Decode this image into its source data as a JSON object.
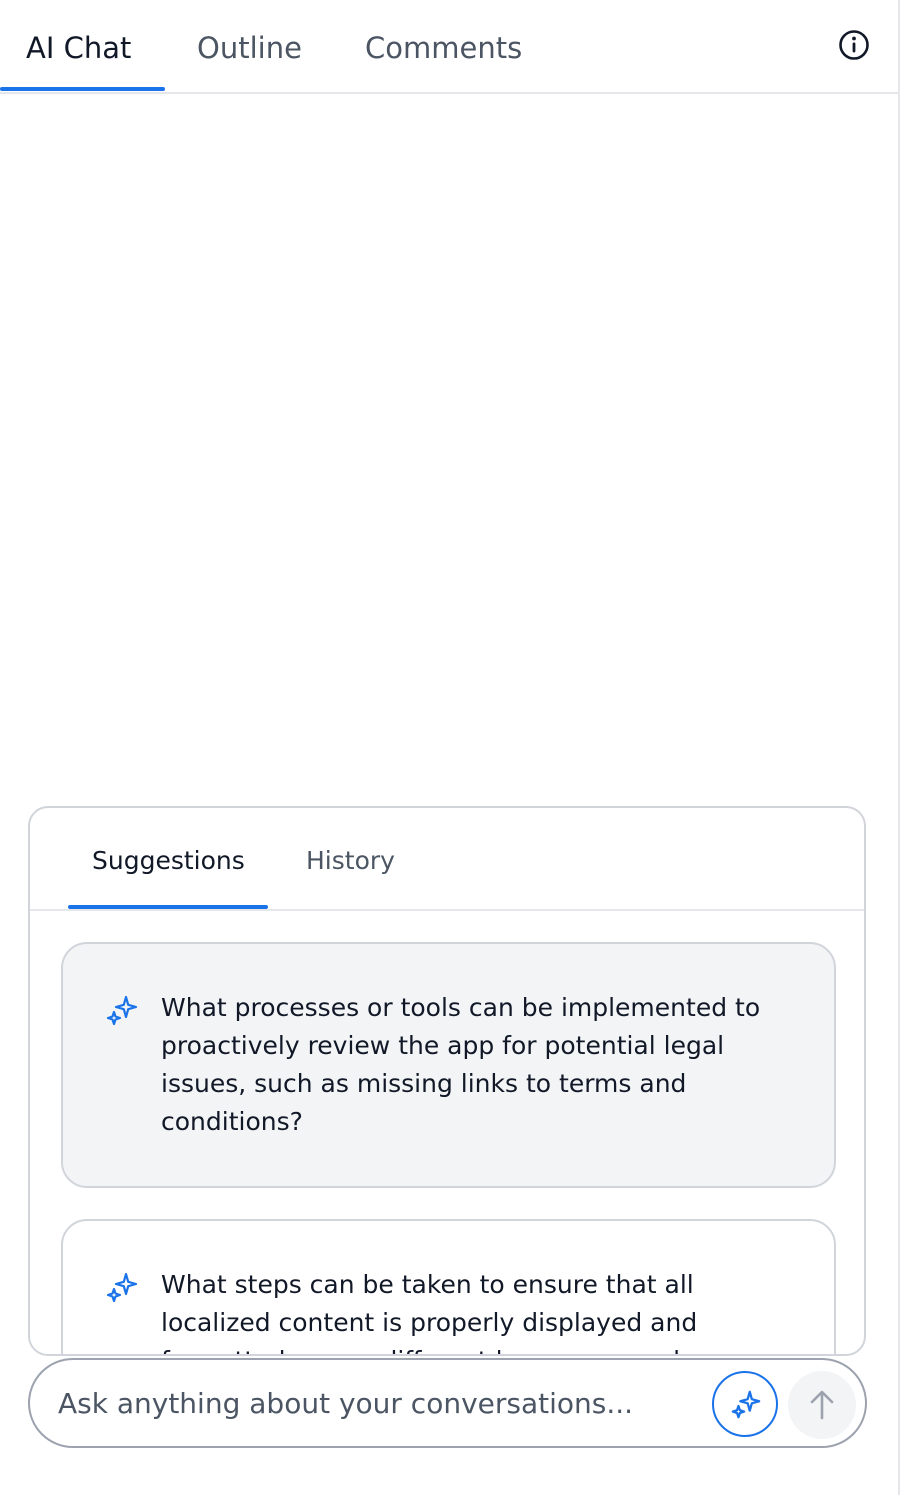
{
  "top_tabs": [
    {
      "label": "AI Chat",
      "active": true
    },
    {
      "label": "Outline",
      "active": false
    },
    {
      "label": "Comments",
      "active": false
    }
  ],
  "info_icon": "info-circle-icon",
  "suggestions_panel": {
    "tabs": [
      {
        "label": "Suggestions",
        "active": true
      },
      {
        "label": "History",
        "active": false
      }
    ],
    "cards": [
      {
        "icon": "sparkle-icon",
        "text": "What processes or tools can be implemented to proactively review the app for potential legal issues, such as missing links to terms and conditions?"
      },
      {
        "icon": "sparkle-icon",
        "text": "What steps can be taken to ensure that all localized content is properly displayed and formatted across different languages and"
      }
    ]
  },
  "chat_input": {
    "placeholder": "Ask anything about your conversations...",
    "value": ""
  },
  "buttons": {
    "sparkle_icon": "sparkle-icon",
    "send_icon": "arrow-up-icon"
  },
  "colors": {
    "accent": "#1a73e8",
    "card_active_bg": "#f3f4f6",
    "border": "#d1d5db"
  }
}
